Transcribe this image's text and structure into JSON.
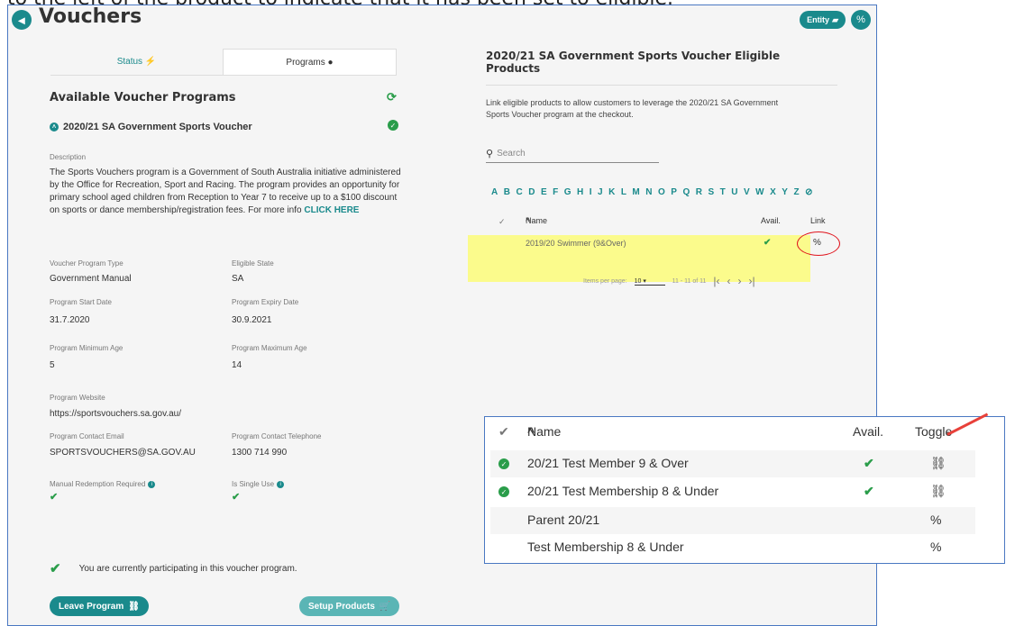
{
  "caption": "to the left of the product to indicate that it has been set to eligible.",
  "header": {
    "title": "Vouchers",
    "entity_label": "Entity"
  },
  "tabs": [
    {
      "label": "Status"
    },
    {
      "label": "Programs"
    }
  ],
  "left": {
    "heading": "Available Voucher Programs",
    "program_name": "2020/21 SA Government Sports Voucher",
    "description_label": "Description",
    "description": "The Sports Vouchers program is a Government of South Australia initiative administered by the Office for Recreation, Sport and Racing. The program provides an opportunity for primary school aged children from Reception to Year 7 to receive up to a $100 discount on sports or dance membership/registration fees. For more info ",
    "description_link": "CLICK HERE",
    "fields": {
      "type_label": "Voucher Program Type",
      "type_value": "Government Manual",
      "state_label": "Eligible State",
      "state_value": "SA",
      "start_label": "Program Start Date",
      "start_value": "31.7.2020",
      "expiry_label": "Program Expiry Date",
      "expiry_value": "30.9.2021",
      "min_age_label": "Program Minimum Age",
      "min_age_value": "5",
      "max_age_label": "Program Maximum Age",
      "max_age_value": "14",
      "website_label": "Program Website",
      "website_value": "https://sportsvouchers.sa.gov.au/",
      "email_label": "Program Contact Email",
      "email_value": "SPORTSVOUCHERS@SA.GOV.AU",
      "phone_label": "Program Contact Telephone",
      "phone_value": "1300 714 990",
      "manual_label": "Manual Redemption Required",
      "single_label": "Is Single Use"
    },
    "participating": "You are currently participating in this voucher program.",
    "leave_label": "Leave Program",
    "setup_label": "Setup Products"
  },
  "right": {
    "title": "2020/21 SA Government Sports Voucher Eligible Products",
    "description": "Link eligible products to allow customers to leverage the 2020/21 SA Government Sports Voucher program at the checkout.",
    "search_placeholder": "Search",
    "alphabet": [
      "A",
      "B",
      "C",
      "D",
      "E",
      "F",
      "G",
      "H",
      "I",
      "J",
      "K",
      "L",
      "M",
      "N",
      "O",
      "P",
      "Q",
      "R",
      "S",
      "T",
      "U",
      "V",
      "W",
      "X",
      "Y",
      "Z"
    ],
    "col_name": "Name",
    "col_avail": "Avail.",
    "col_link": "Link",
    "product": "2019/20 Swimmer (9&Over)",
    "items_per_page_label": "Items per page:",
    "items_per_page": "10",
    "range": "11 - 11 of 11"
  },
  "popup": {
    "col_name": "Name",
    "col_avail": "Avail.",
    "col_toggle": "Toggle",
    "rows": [
      {
        "name": "20/21 Test Member 9 & Over"
      },
      {
        "name": "20/21 Test Membership 8 & Under"
      },
      {
        "name": "Parent 20/21"
      },
      {
        "name": "Test Membership 8 & Under"
      }
    ]
  }
}
